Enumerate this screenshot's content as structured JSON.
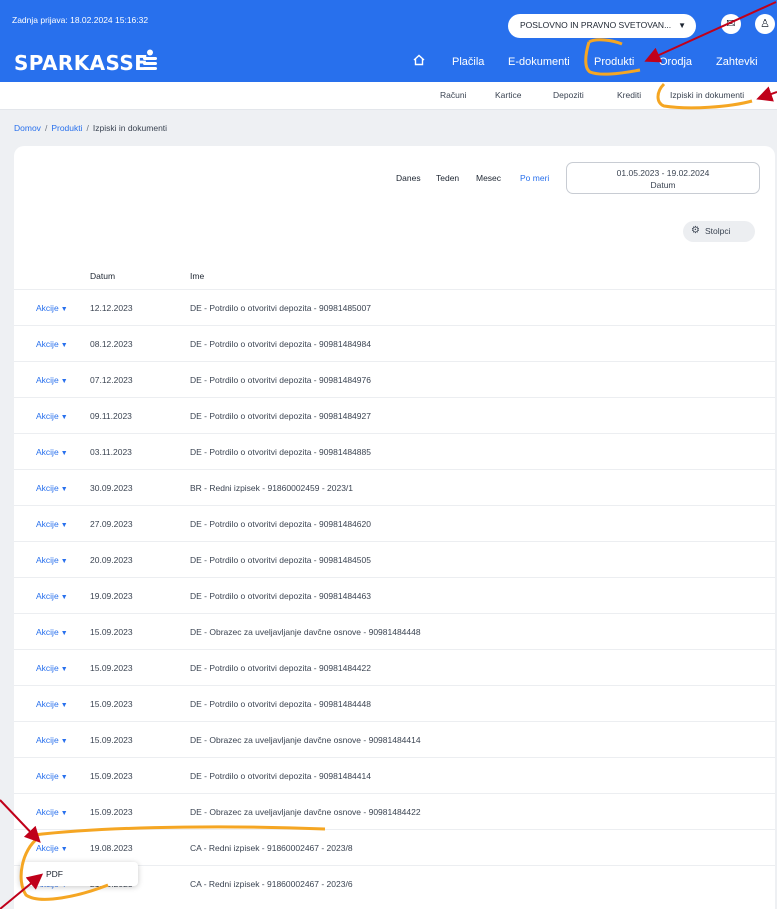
{
  "header": {
    "last_login": "Zadnja prijava: 18.02.2024 15:16:32",
    "logo": "SPARKASSE",
    "company_select": "POSLOVNO IN PRAVNO SVETOVAN...",
    "nav": [
      "Plačila",
      "E-dokumenti",
      "Produkti",
      "Orodja",
      "Zahtevki"
    ]
  },
  "subnav": [
    "Računi",
    "Kartice",
    "Depoziti",
    "Krediti",
    "Izpiski in dokumenti"
  ],
  "breadcrumb": {
    "home": "Domov",
    "products": "Produkti",
    "current": "Izpiski in dokumenti"
  },
  "filter": {
    "today": "Danes",
    "week": "Teden",
    "month": "Mesec",
    "custom": "Po meri",
    "date_range": "01.05.2023 - 19.02.2024",
    "date_label": "Datum",
    "columns_btn": "Stolpci"
  },
  "table": {
    "headers": {
      "date": "Datum",
      "name": "Ime"
    },
    "actions_label": "Akcije",
    "rows": [
      {
        "date": "12.12.2023",
        "name": "DE - Potrdilo o otvoritvi depozita - 90981485007"
      },
      {
        "date": "08.12.2023",
        "name": "DE - Potrdilo o otvoritvi depozita - 90981484984"
      },
      {
        "date": "07.12.2023",
        "name": "DE - Potrdilo o otvoritvi depozita - 90981484976"
      },
      {
        "date": "09.11.2023",
        "name": "DE - Potrdilo o otvoritvi depozita - 90981484927"
      },
      {
        "date": "03.11.2023",
        "name": "DE - Potrdilo o otvoritvi depozita - 90981484885"
      },
      {
        "date": "30.09.2023",
        "name": "BR - Redni izpisek - 91860002459 - 2023/1"
      },
      {
        "date": "27.09.2023",
        "name": "DE - Potrdilo o otvoritvi depozita - 90981484620"
      },
      {
        "date": "20.09.2023",
        "name": "DE - Potrdilo o otvoritvi depozita - 90981484505"
      },
      {
        "date": "19.09.2023",
        "name": "DE - Potrdilo o otvoritvi depozita - 90981484463"
      },
      {
        "date": "15.09.2023",
        "name": "DE - Obrazec za uveljavljanje davčne osnove - 90981484448"
      },
      {
        "date": "15.09.2023",
        "name": "DE - Potrdilo o otvoritvi depozita - 90981484422"
      },
      {
        "date": "15.09.2023",
        "name": "DE - Potrdilo o otvoritvi depozita - 90981484448"
      },
      {
        "date": "15.09.2023",
        "name": "DE - Obrazec za uveljavljanje davčne osnove - 90981484414"
      },
      {
        "date": "15.09.2023",
        "name": "DE - Potrdilo o otvoritvi depozita - 90981484414"
      },
      {
        "date": "15.09.2023",
        "name": "DE - Obrazec za uveljavljanje davčne osnove - 90981484422"
      },
      {
        "date": "19.08.2023",
        "name": "CA - Redni izpisek - 91860002467 - 2023/8"
      },
      {
        "date": "21.06.2023",
        "name": "CA - Redni izpisek - 91860002467 - 2023/6"
      }
    ]
  },
  "dropdown": {
    "pdf": "PDF"
  },
  "colors": {
    "brand": "#2870ed",
    "annotation_marker": "#f5a623",
    "annotation_arrow": "#c0001a"
  }
}
